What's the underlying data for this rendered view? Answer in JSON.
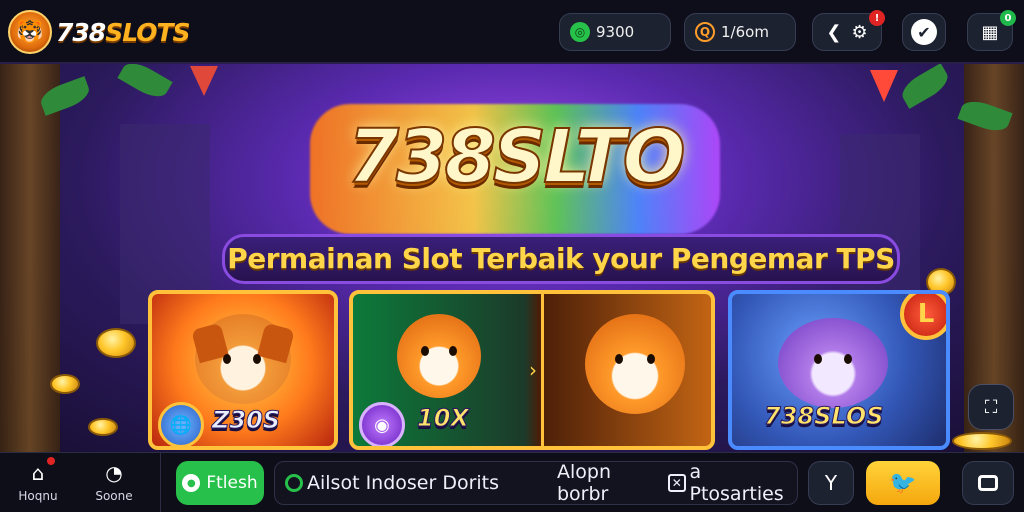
{
  "header": {
    "logo_text_main": "738",
    "logo_text_accent": "SLOTS",
    "logo_icon": "tiger-face-icon",
    "balance": "9300",
    "balance_icon": "wallet-icon",
    "bonus": "1/6om",
    "bonus_icon": "coin-icon",
    "settings_badge": "!",
    "grid_badge": "0"
  },
  "banner": {
    "title": "738SLTO",
    "subtitle": "Permainan Slot Terbaik your Pengemar TPS",
    "cards": [
      {
        "label": "Z30S",
        "emblem_icon": "globe-emblem-icon",
        "character": "dog"
      },
      {
        "label": "10X",
        "emblem_icon": "purple-orb-icon",
        "character": "tiger"
      },
      {
        "label": "738SLOS",
        "emblem_icon": "L",
        "character": "purple-tiger"
      }
    ]
  },
  "bottom": {
    "nav": [
      {
        "label": "Hoqnu",
        "icon": "home-icon"
      },
      {
        "label": "Sоone",
        "icon": "clock-icon"
      }
    ],
    "fresh_label": "Ftlesh",
    "ticker_left": "Ailsot Indoser Dorits",
    "ticker_right": "Alopn borbr",
    "ticker_right_tail": "a Ptosarties"
  },
  "colors": {
    "accent_gold": "#ffc23a",
    "accent_green": "#27c04a",
    "background": "#0d0e1a"
  }
}
